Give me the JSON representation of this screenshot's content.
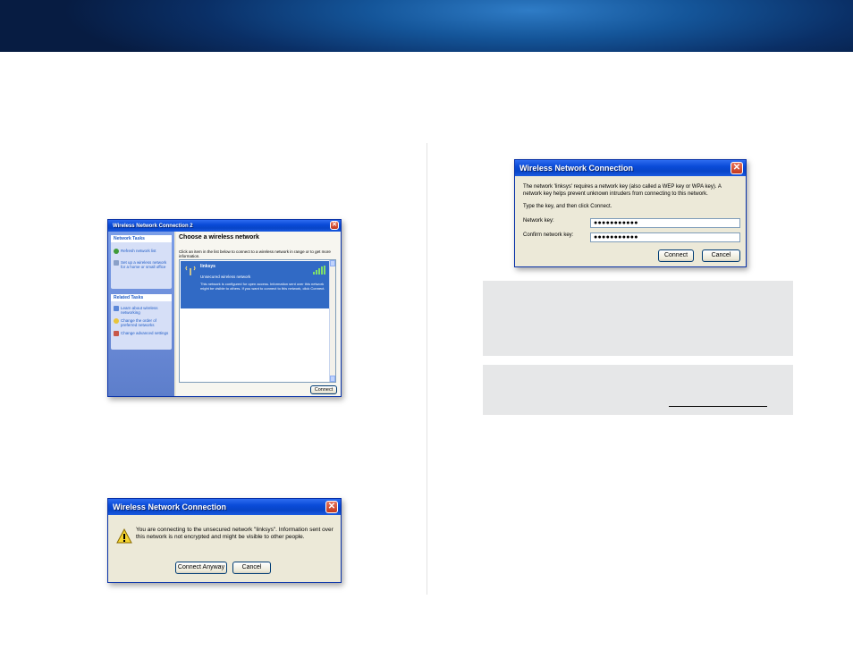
{
  "colors": {
    "banner": "#0a2f66",
    "xp_title": "#0a4bd8",
    "window_bg": "#ece9d8",
    "selected_network": "#316ac5",
    "note_bg": "#e6e7e8"
  },
  "choose_window": {
    "title": "Wireless Network Connection 2",
    "network_tasks": {
      "header": "Network Tasks",
      "items": [
        "Refresh network list",
        "Set up a wireless network for a home or small office"
      ]
    },
    "related_tasks": {
      "header": "Related Tasks",
      "items": [
        "Learn about wireless networking",
        "Change the order of preferred networks",
        "Change advanced settings"
      ]
    },
    "heading": "Choose a wireless network",
    "instructions": "Click an item in the list below to connect to a wireless network in range or to get more information.",
    "selected_network": {
      "name": "linksys",
      "status": "Unsecured wireless network",
      "description": "This network is configured for open access. Information sent over this network might be visible to others. If you want to connect to this network, click Connect."
    },
    "connect_label": "Connect"
  },
  "key_window": {
    "title": "Wireless Network Connection",
    "message": "The network 'linksys' requires a network key (also called a WEP key or WPA key). A network key helps prevent unknown intruders from connecting to this network.",
    "instruction": "Type the key, and then click Connect.",
    "network_key_label": "Network key:",
    "network_key_value": "●●●●●●●●●●●",
    "confirm_key_label": "Confirm network key:",
    "confirm_key_value": "●●●●●●●●●●●",
    "connect_label": "Connect",
    "cancel_label": "Cancel"
  },
  "warning_window": {
    "title": "Wireless Network Connection",
    "message": "You are connecting to the unsecured network \"linksys\". Information sent over this network is not encrypted and might be visible to other people.",
    "connect_anyway_label": "Connect Anyway",
    "cancel_label": "Cancel"
  }
}
